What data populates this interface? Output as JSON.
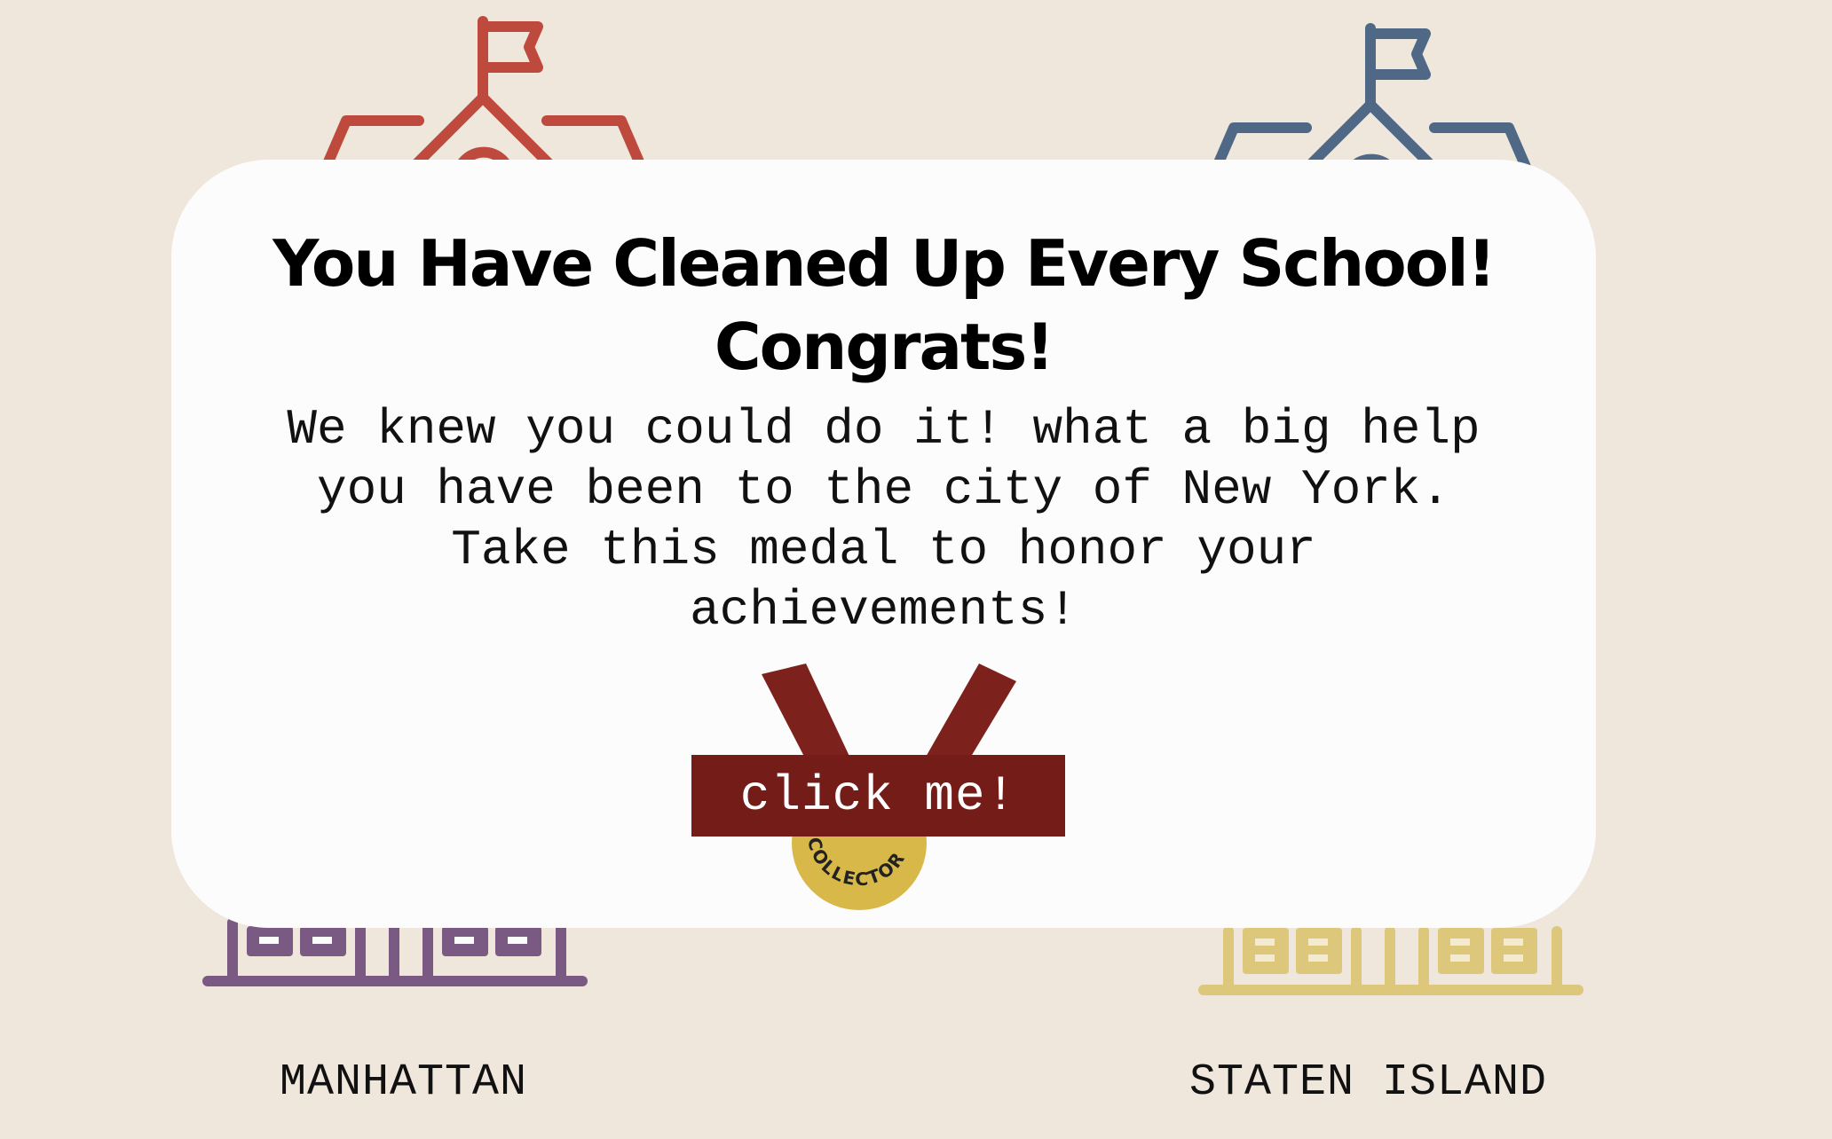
{
  "boroughs": [
    {
      "id": "bronx",
      "color": "#bd4a3d"
    },
    {
      "id": "queens",
      "color": "#4f6886"
    },
    {
      "id": "manhattan",
      "label": "MANHATTAN",
      "color": "#7a5a82"
    },
    {
      "id": "staten_island",
      "label": "STATEN ISLAND",
      "color": "#dcc77a"
    }
  ],
  "modal": {
    "title_line1": "You Have Cleaned Up Every School!",
    "title_line2": "Congrats!",
    "body": "We knew you could do it! what a big help you have been to the city of New York. Take this medal to honor your achievements!",
    "medal": {
      "icon": "medal-icon",
      "ribbon_color": "#7d211d",
      "coin_color": "#d9b84a",
      "coin_text": "COLLECTOR"
    },
    "button_label": "click me!"
  }
}
